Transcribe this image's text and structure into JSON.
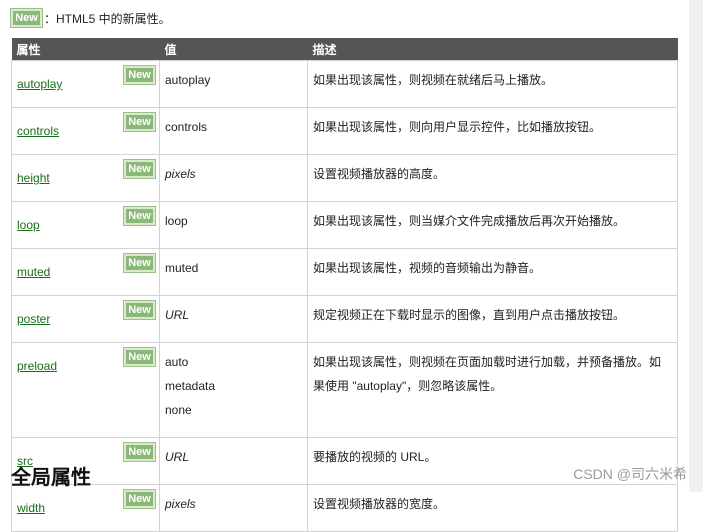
{
  "legend": {
    "badge": "New",
    "text": "：HTML5 中的新属性。"
  },
  "table": {
    "headers": [
      "属性",
      "值",
      "描述"
    ],
    "rows": [
      {
        "attr": "autoplay",
        "badge": "New",
        "values": [
          "autoplay"
        ],
        "italic": false,
        "desc": "如果出现该属性，则视频在就绪后马上播放。"
      },
      {
        "attr": "controls",
        "badge": "New",
        "values": [
          "controls"
        ],
        "italic": false,
        "desc": "如果出现该属性，则向用户显示控件，比如播放按钮。"
      },
      {
        "attr": "height",
        "badge": "New",
        "values": [
          "pixels"
        ],
        "italic": true,
        "desc": "设置视频播放器的高度。"
      },
      {
        "attr": "loop",
        "badge": "New",
        "values": [
          "loop"
        ],
        "italic": false,
        "desc": "如果出现该属性，则当媒介文件完成播放后再次开始播放。"
      },
      {
        "attr": "muted",
        "badge": "New",
        "values": [
          "muted"
        ],
        "italic": false,
        "desc": "如果出现该属性，视频的音频输出为静音。"
      },
      {
        "attr": "poster",
        "badge": "New",
        "values": [
          "URL"
        ],
        "italic": true,
        "desc": "规定视频正在下载时显示的图像，直到用户点击播放按钮。"
      },
      {
        "attr": "preload",
        "badge": "New",
        "values": [
          "auto",
          "metadata",
          "none"
        ],
        "italic": false,
        "desc": "如果出现该属性，则视频在页面加载时进行加载，并预备播放。如果使用 \"autoplay\"，则忽略该属性。"
      },
      {
        "attr": "src",
        "badge": "New",
        "values": [
          "URL"
        ],
        "italic": true,
        "desc": "要播放的视频的 URL。"
      },
      {
        "attr": "width",
        "badge": "New",
        "values": [
          "pixels"
        ],
        "italic": true,
        "desc": "设置视频播放器的宽度。"
      }
    ]
  },
  "section_heading": "全局属性",
  "watermark": "CSDN @司六米希"
}
